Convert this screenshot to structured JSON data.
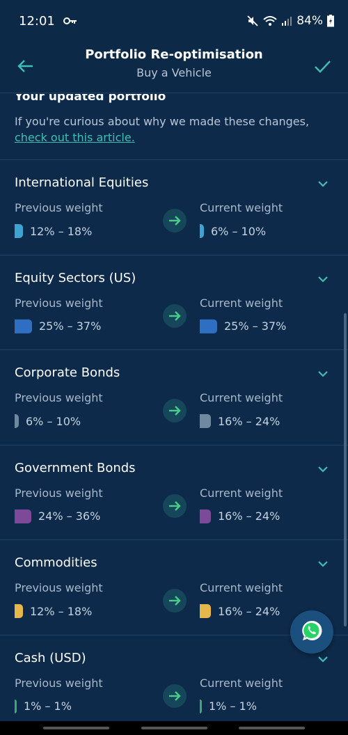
{
  "status": {
    "time": "12:01",
    "battery": "84%"
  },
  "header": {
    "title": "Portfolio Re-optimisation",
    "subtitle": "Buy a Vehicle"
  },
  "intro": {
    "title": "Your updated portfolio",
    "text": "If you're curious about why we made these changes,",
    "link": "check out this article."
  },
  "labels": {
    "previous": "Previous weight",
    "current": "Current weight"
  },
  "assets": [
    {
      "name": "International Equities",
      "prev": "12% – 18%",
      "curr": "6% – 10%",
      "color": "#3fa3d1",
      "prev_fill": 0.15,
      "curr_fill": 0.08
    },
    {
      "name": "Equity Sectors (US)",
      "prev": "25% – 37%",
      "curr": "25% – 37%",
      "color": "#2e6fc4",
      "prev_fill": 0.31,
      "curr_fill": 0.31
    },
    {
      "name": "Corporate Bonds",
      "prev": "6% – 10%",
      "curr": "16% – 24%",
      "color": "#6f8aa0",
      "prev_fill": 0.08,
      "curr_fill": 0.2
    },
    {
      "name": "Government Bonds",
      "prev": "24% – 36%",
      "curr": "16% – 24%",
      "color": "#7d4a9a",
      "prev_fill": 0.3,
      "curr_fill": 0.2
    },
    {
      "name": "Commodities",
      "prev": "12% – 18%",
      "curr": "16% – 24%",
      "color": "#e4b84a",
      "prev_fill": 0.15,
      "curr_fill": 0.2
    },
    {
      "name": "Cash (USD)",
      "prev": "1% – 1%",
      "curr": "1% – 1%",
      "color": "#3fa86e",
      "prev_fill": 0.01,
      "curr_fill": 0.01
    }
  ],
  "colors": {
    "background": "#0d2a4a",
    "accent": "#3fbfb4",
    "arrow": "#4ccc8a"
  }
}
